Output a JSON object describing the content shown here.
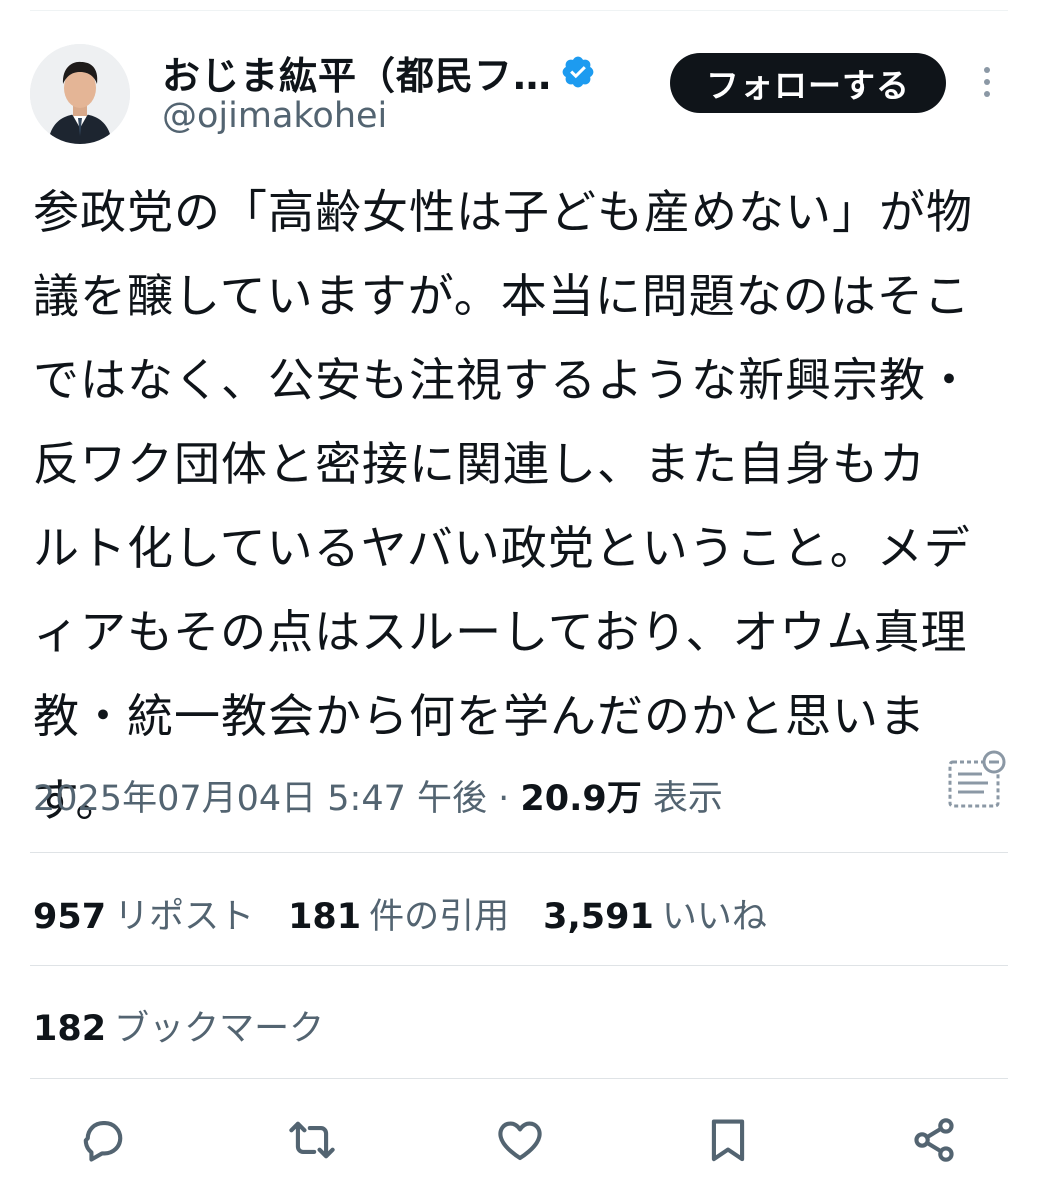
{
  "author": {
    "display_name": "おじま紘平（都民フ…",
    "handle": "@ojimakohei",
    "verified": true,
    "verified_color": "#1d9bf0"
  },
  "follow_button": {
    "label": "フォローする"
  },
  "tweet": {
    "lines": [
      "参政党の「高齢女性は子ども産めない」が物",
      "議を醸していますが。本当に問題なのはそこ",
      "ではなく、公安も注視するような新興宗教・",
      "反ワク団体と密接に関連し、また自身もカ",
      "ルト化しているヤバい政党ということ。メデ",
      "ィアもその点はスルーしており、オウム真理",
      "教・統一教会から何を学んだのかと思いま",
      "す。"
    ]
  },
  "meta": {
    "timestamp": "2025年07月04日 5:47 午後",
    "separator": " · ",
    "views_count": "20.9万",
    "views_label": "表示"
  },
  "stats": {
    "reposts_count": "957",
    "reposts_label": "リポスト",
    "quotes_count": "181",
    "quotes_label": "件の引用",
    "likes_count": "3,591",
    "likes_label": "いいね",
    "bookmarks_count": "182",
    "bookmarks_label": "ブックマーク"
  },
  "icons": {
    "more": "more-vertical-icon",
    "translate": "document-icon",
    "reply": "reply-icon",
    "repost": "repost-icon",
    "like": "heart-icon",
    "bookmark": "bookmark-icon",
    "share": "share-icon"
  }
}
